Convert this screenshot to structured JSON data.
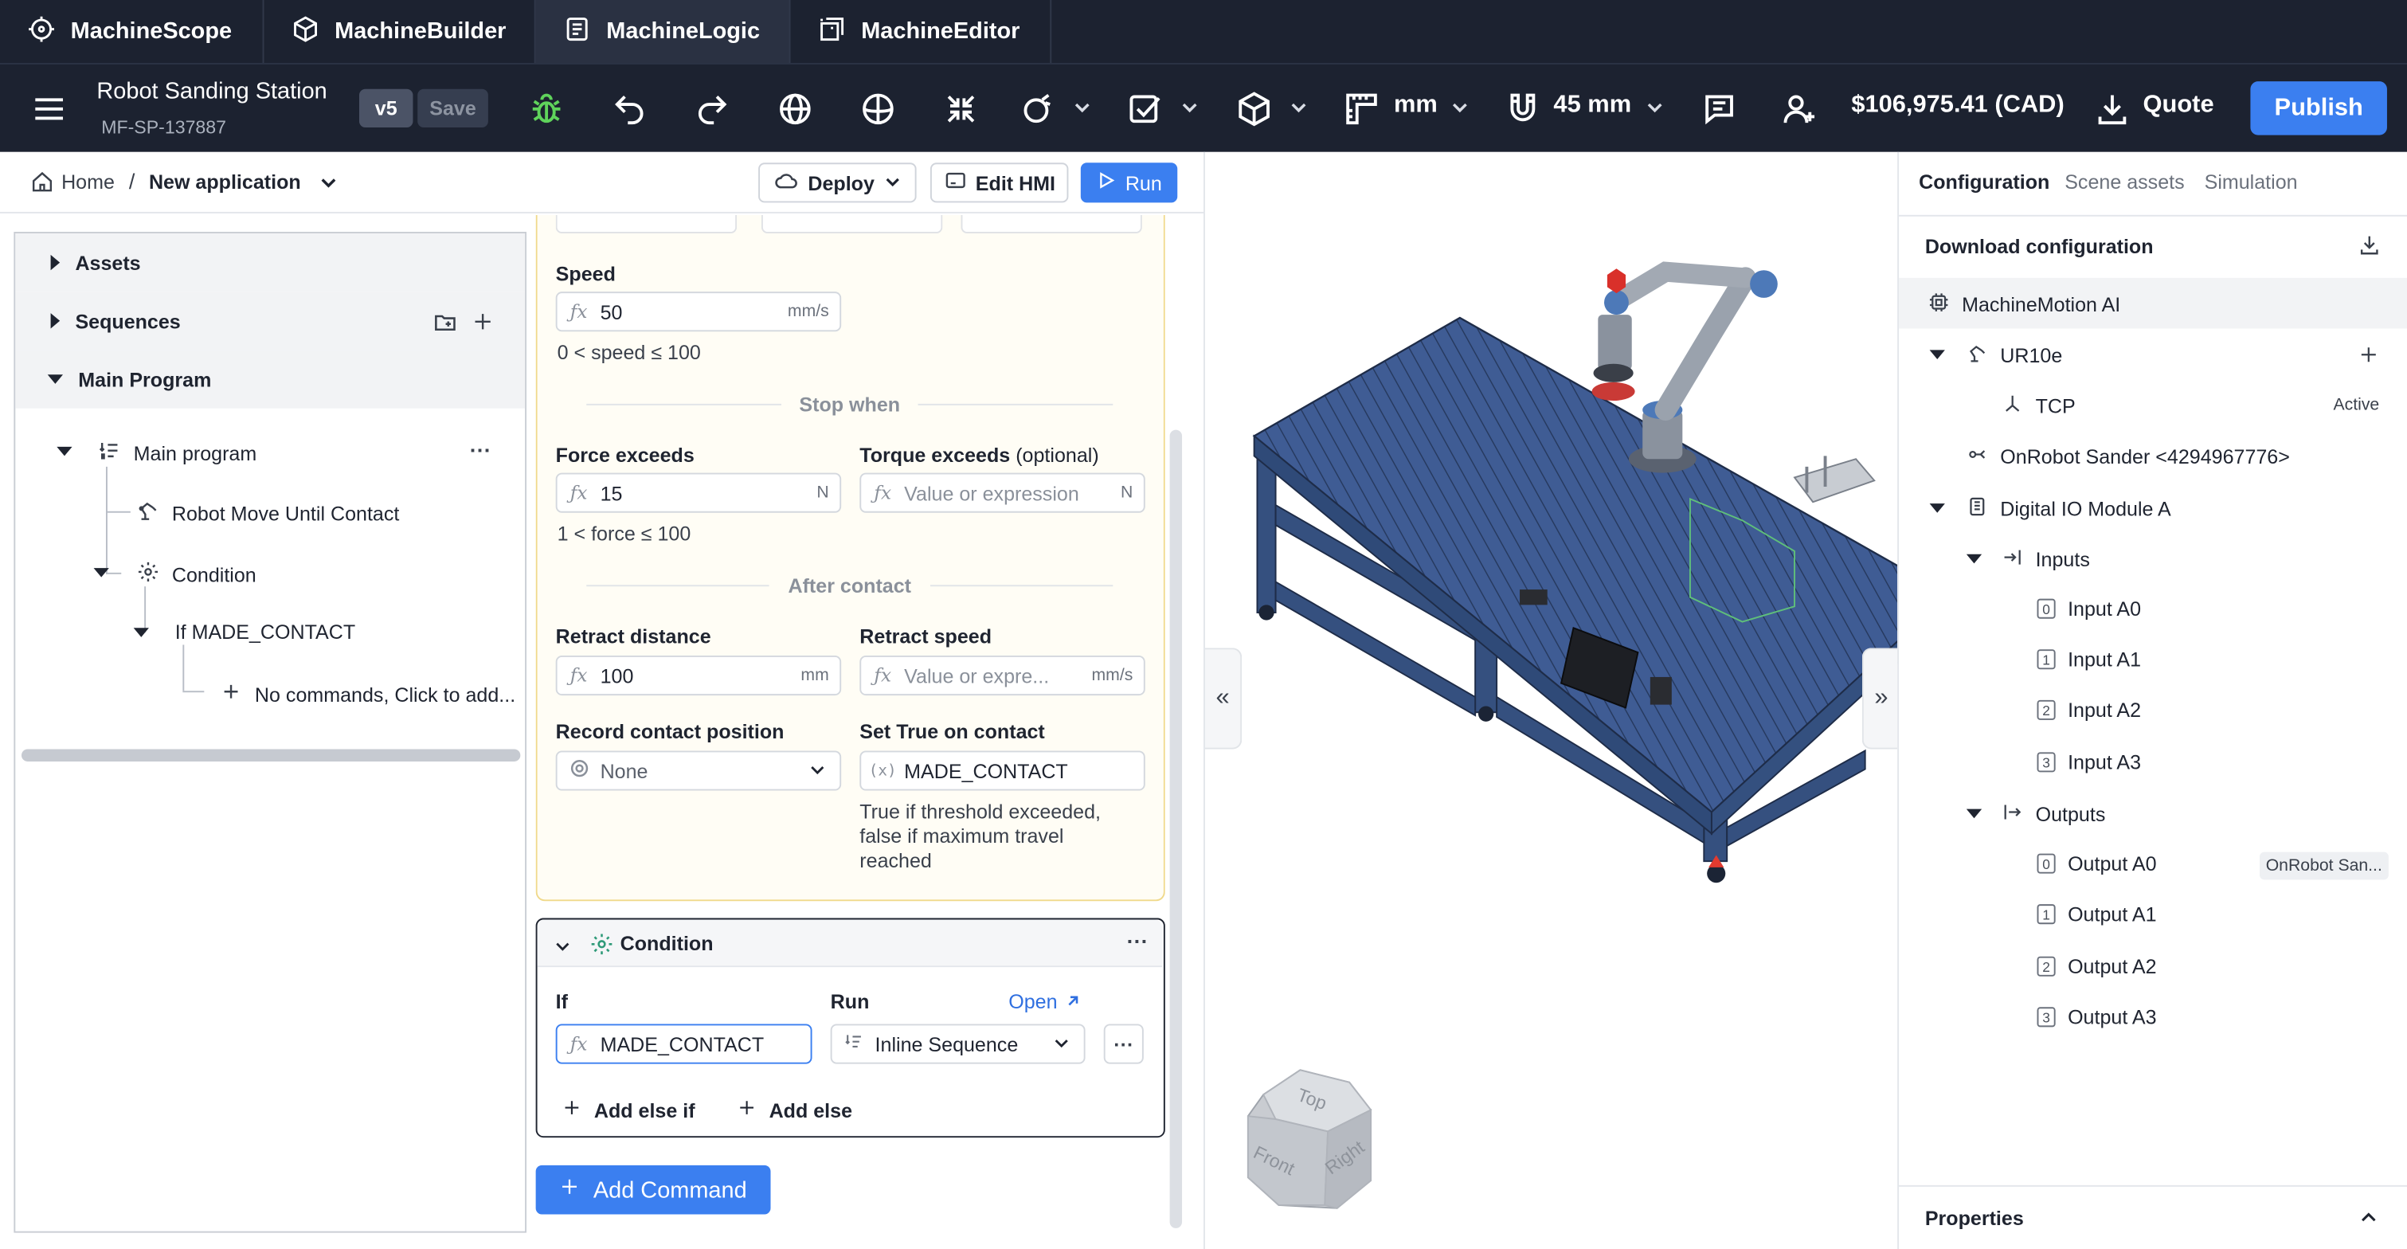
{
  "app_tabs": [
    {
      "label": "MachineScope",
      "icon": "scope-icon"
    },
    {
      "label": "MachineBuilder",
      "icon": "cube-icon"
    },
    {
      "label": "MachineLogic",
      "icon": "logic-icon"
    },
    {
      "label": "MachineEditor",
      "icon": "editor-icon"
    }
  ],
  "toolbar": {
    "project_name": "Robot Sanding Station",
    "project_id": "MF-SP-137887",
    "version": "v5",
    "save_label": "Save",
    "units": "mm",
    "snap": "45 mm",
    "price": "$106,975.41 (CAD)",
    "quote_label": "Quote",
    "publish_label": "Publish"
  },
  "breadcrumb": {
    "home": "Home",
    "current": "New application"
  },
  "actions": {
    "deploy": "Deploy",
    "edit_hmi": "Edit HMI",
    "run": "Run"
  },
  "tree": {
    "assets": "Assets",
    "sequences": "Sequences",
    "main_program": "Main Program",
    "items": {
      "main": "Main program",
      "move": "Robot Move Until Contact",
      "condition": "Condition",
      "if": "If MADE_CONTACT",
      "empty": "No commands, Click to add..."
    }
  },
  "move_card": {
    "speed_label": "Speed",
    "speed_value": "50",
    "speed_unit": "mm/s",
    "speed_hint": "0 < speed ≤ 100",
    "stop_when": "Stop when",
    "force_label": "Force exceeds",
    "force_value": "15",
    "force_unit": "N",
    "force_hint": "1 < force ≤ 100",
    "torque_label": "Torque exceeds",
    "torque_optional": "(optional)",
    "torque_placeholder": "Value or expression",
    "torque_unit": "N",
    "after_contact": "After contact",
    "retract_distance_label": "Retract distance",
    "retract_distance_value": "100",
    "retract_distance_unit": "mm",
    "retract_speed_label": "Retract speed",
    "retract_speed_placeholder": "Value or expre...",
    "retract_speed_unit": "mm/s",
    "record_label": "Record contact position",
    "record_value": "None",
    "set_true_label": "Set True on contact",
    "set_true_value": "MADE_CONTACT",
    "set_true_hint": "True if threshold exceeded, false if maximum travel reached"
  },
  "condition_card": {
    "title": "Condition",
    "if_label": "If",
    "if_value": "MADE_CONTACT",
    "run_label": "Run",
    "open_link": "Open",
    "run_value": "Inline Sequence",
    "add_else_if": "Add else if",
    "add_else": "Add else"
  },
  "add_command": "Add Command",
  "view_cube": {
    "top": "Top",
    "front": "Front",
    "right": "Right"
  },
  "right_panel": {
    "tabs": [
      "Configuration",
      "Scene assets",
      "Simulation"
    ],
    "download": "Download configuration",
    "items": {
      "machinemotion": "MachineMotion AI",
      "ur10e": "UR10e",
      "tcp": "TCP",
      "tcp_status": "Active",
      "sander": "OnRobot Sander <4294967776>",
      "io": "Digital IO Module A",
      "inputs": "Inputs",
      "outputs": "Outputs",
      "input_list": [
        "Input A0",
        "Input A1",
        "Input A2",
        "Input A3"
      ],
      "output_list": [
        "Output A0",
        "Output A1",
        "Output A2",
        "Output A3"
      ],
      "output0_badge": "OnRobot San..."
    },
    "properties": "Properties"
  },
  "colors": {
    "nav_bg": "#1c2230",
    "accent": "#3b7ff0",
    "frame_blue": "#3a5588"
  }
}
